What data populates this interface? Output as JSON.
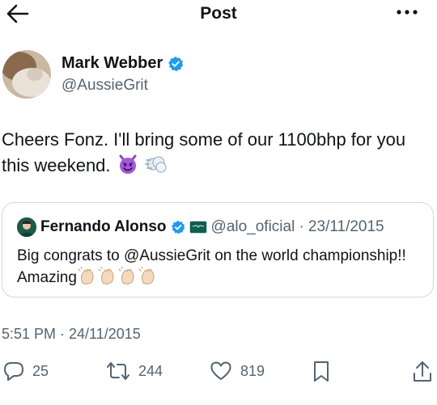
{
  "header": {
    "title": "Post",
    "back_icon": "arrow-left-icon",
    "more_icon": "more-horizontal-icon"
  },
  "author": {
    "name": "Mark Webber",
    "handle": "@AussieGrit",
    "verified": true
  },
  "post": {
    "text": "Cheers Fonz. I'll bring some of our 1100bhp for you this weekend.",
    "emojis": [
      "smiling-devil-icon",
      "dash-icon"
    ],
    "timestamp": "5:51 PM · 24/11/2015"
  },
  "quote": {
    "name": "Fernando Alonso",
    "handle": "@alo_oficial",
    "date": "· 23/11/2015",
    "text": "Big congrats to @AussieGrit on the world championship!! Amazing",
    "emojis": [
      "clapping-hands-icon",
      "clapping-hands-icon",
      "clapping-hands-icon",
      "clapping-hands-icon"
    ]
  },
  "actions": {
    "replies": "25",
    "reposts": "244",
    "likes": "819"
  },
  "colors": {
    "text": "#0f1419",
    "muted": "#536471",
    "verified": "#1d9bf0",
    "border": "#cfd9de"
  }
}
